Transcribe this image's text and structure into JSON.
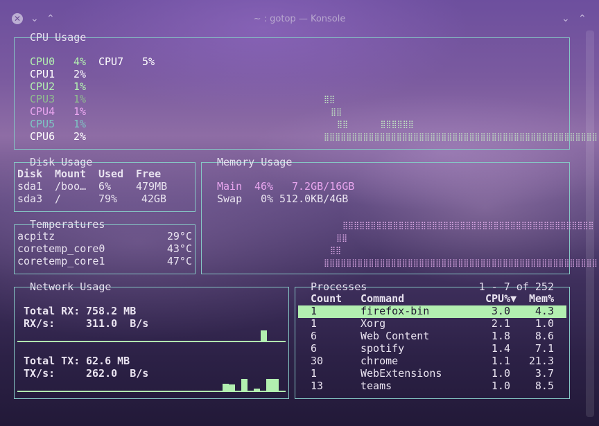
{
  "window": {
    "title": "~ : gotop — Konsole",
    "close_glyph": "✕",
    "down_glyph": "⌄",
    "up_glyph": "⌃",
    "min_glyph": "⌄",
    "max_glyph": "⌃"
  },
  "cpu": {
    "title": "CPU Usage",
    "cores": [
      {
        "name": "CPU0",
        "pct": "4%",
        "color": "#b2efb0"
      },
      {
        "name": "CPU1",
        "pct": "2%",
        "color": "#ffffff"
      },
      {
        "name": "CPU2",
        "pct": "1%",
        "color": "#b2efb0"
      },
      {
        "name": "CPU3",
        "pct": "1%",
        "color": "#8fbf8e"
      },
      {
        "name": "CPU4",
        "pct": "1%",
        "color": "#e9a6ef"
      },
      {
        "name": "CPU5",
        "pct": "1%",
        "color": "#7ec6c4"
      },
      {
        "name": "CPU6",
        "pct": "2%",
        "color": "#ffffff"
      },
      {
        "name": "CPU7",
        "pct": "5%",
        "color": "#ffffff"
      }
    ]
  },
  "disk": {
    "title": "Disk Usage",
    "headers": [
      "Disk",
      "Mount",
      "Used",
      "Free"
    ],
    "rows": [
      [
        "sda1",
        "/boo…",
        "6%",
        "479MB"
      ],
      [
        "sda3",
        "/",
        "79%",
        "42GB"
      ]
    ]
  },
  "memory": {
    "title": "Memory Usage",
    "main": {
      "label": "Main",
      "pct": "46%",
      "value": "7.2GB/16GB"
    },
    "swap": {
      "label": "Swap",
      "pct": "0%",
      "value": "512.0KB/4GB"
    }
  },
  "temps": {
    "title": "Temperatures",
    "rows": [
      {
        "name": "acpitz",
        "value": "29°C"
      },
      {
        "name": "coretemp_core0",
        "value": "43°C"
      },
      {
        "name": "coretemp_core1",
        "value": "47°C"
      }
    ]
  },
  "network": {
    "title": "Network Usage",
    "rx_total_label": "Total RX:",
    "rx_total": "758.2 MB",
    "rx_rate_label": "RX/s:",
    "rx_rate": "311.0  B/s",
    "tx_total_label": "Total TX:",
    "tx_total": "62.6 MB",
    "tx_rate_label": "TX/s:",
    "tx_rate": "262.0  B/s"
  },
  "processes": {
    "title": "Processes",
    "range": "1 - 7 of 252",
    "headers": [
      "Count",
      "Command",
      "CPU%▼",
      "Mem%"
    ],
    "rows": [
      [
        "1",
        "firefox-bin",
        "3.0",
        "4.3"
      ],
      [
        "1",
        "Xorg",
        "2.1",
        "1.0"
      ],
      [
        "6",
        "Web Content",
        "1.8",
        "8.6"
      ],
      [
        "6",
        "spotify",
        "1.4",
        "7.1"
      ],
      [
        "30",
        "chrome",
        "1.1",
        "21.3"
      ],
      [
        "1",
        "WebExtensions",
        "1.0",
        "3.7"
      ],
      [
        "13",
        "teams",
        "1.0",
        "8.5"
      ]
    ]
  },
  "graphs": {
    "cpu_row1": "⣿⣿",
    "cpu_row2": "⣿⣿",
    "cpu_row3": "⣿⣿       ⣿⣿⣿⣿⣿⣿",
    "cpu_row4": "⣿⣿⣿⣿⣿⣿⣿⣿⣿⣿⣿⣿⣿⣿⣿⣿⣿⣿⣿⣿⣿⣿⣿⣿⣿⣿⣿⣿⣿⣿⣿⣿⣿⣿⣿⣿⣿⣿⣿⣿⣿⣿⣿⣿⣿⣿⣿⣿⣿",
    "mem_row1": "⣿⣿⣿⣿⣿⣿⣿⣿⣿⣿⣿⣿⣿⣿⣿⣿⣿⣿⣿⣿⣿⣿⣿⣿⣿⣿⣿⣿⣿⣿⣿⣿⣿⣿⣿⣿⣿⣿⣿⣿⣿⣿⣿⣿⣿",
    "mem_row2": "⣿⣿",
    "mem_row3": "⣿⣿",
    "mem_row4": "⣿⣿⣿⣿⣿⣿⣿⣿⣿⣿⣿⣿⣿⣿⣿⣿⣿⣿⣿⣿⣿⣿⣿⣿⣿⣿⣿⣿⣿⣿⣿⣿⣿⣿⣿⣿⣿⣿⣿⣿⣿⣿⣿⣿⣿⣿⣿⣿⣿",
    "rx_spark_level": 0.9,
    "tx_spark_levels": [
      0.6,
      0.5,
      0.0,
      1.0,
      0.0,
      0.15,
      0.0,
      1.0,
      1.0
    ]
  }
}
